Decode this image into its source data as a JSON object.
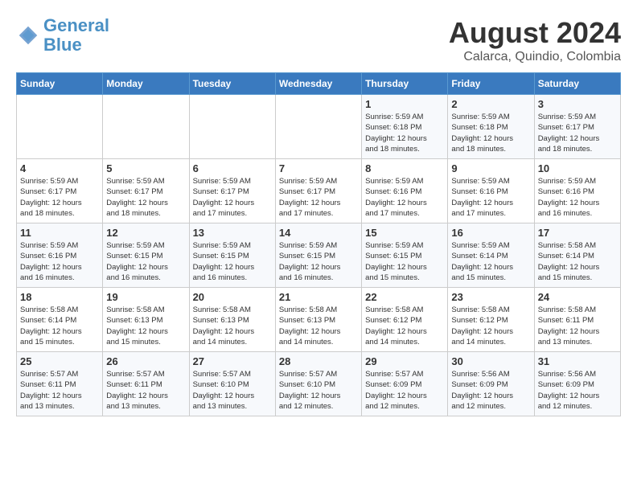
{
  "header": {
    "logo_line1": "General",
    "logo_line2": "Blue",
    "month_year": "August 2024",
    "location": "Calarca, Quindio, Colombia"
  },
  "weekdays": [
    "Sunday",
    "Monday",
    "Tuesday",
    "Wednesday",
    "Thursday",
    "Friday",
    "Saturday"
  ],
  "weeks": [
    [
      {
        "day": "",
        "detail": ""
      },
      {
        "day": "",
        "detail": ""
      },
      {
        "day": "",
        "detail": ""
      },
      {
        "day": "",
        "detail": ""
      },
      {
        "day": "1",
        "detail": "Sunrise: 5:59 AM\nSunset: 6:18 PM\nDaylight: 12 hours\nand 18 minutes."
      },
      {
        "day": "2",
        "detail": "Sunrise: 5:59 AM\nSunset: 6:18 PM\nDaylight: 12 hours\nand 18 minutes."
      },
      {
        "day": "3",
        "detail": "Sunrise: 5:59 AM\nSunset: 6:17 PM\nDaylight: 12 hours\nand 18 minutes."
      }
    ],
    [
      {
        "day": "4",
        "detail": "Sunrise: 5:59 AM\nSunset: 6:17 PM\nDaylight: 12 hours\nand 18 minutes."
      },
      {
        "day": "5",
        "detail": "Sunrise: 5:59 AM\nSunset: 6:17 PM\nDaylight: 12 hours\nand 18 minutes."
      },
      {
        "day": "6",
        "detail": "Sunrise: 5:59 AM\nSunset: 6:17 PM\nDaylight: 12 hours\nand 17 minutes."
      },
      {
        "day": "7",
        "detail": "Sunrise: 5:59 AM\nSunset: 6:17 PM\nDaylight: 12 hours\nand 17 minutes."
      },
      {
        "day": "8",
        "detail": "Sunrise: 5:59 AM\nSunset: 6:16 PM\nDaylight: 12 hours\nand 17 minutes."
      },
      {
        "day": "9",
        "detail": "Sunrise: 5:59 AM\nSunset: 6:16 PM\nDaylight: 12 hours\nand 17 minutes."
      },
      {
        "day": "10",
        "detail": "Sunrise: 5:59 AM\nSunset: 6:16 PM\nDaylight: 12 hours\nand 16 minutes."
      }
    ],
    [
      {
        "day": "11",
        "detail": "Sunrise: 5:59 AM\nSunset: 6:16 PM\nDaylight: 12 hours\nand 16 minutes."
      },
      {
        "day": "12",
        "detail": "Sunrise: 5:59 AM\nSunset: 6:15 PM\nDaylight: 12 hours\nand 16 minutes."
      },
      {
        "day": "13",
        "detail": "Sunrise: 5:59 AM\nSunset: 6:15 PM\nDaylight: 12 hours\nand 16 minutes."
      },
      {
        "day": "14",
        "detail": "Sunrise: 5:59 AM\nSunset: 6:15 PM\nDaylight: 12 hours\nand 16 minutes."
      },
      {
        "day": "15",
        "detail": "Sunrise: 5:59 AM\nSunset: 6:15 PM\nDaylight: 12 hours\nand 15 minutes."
      },
      {
        "day": "16",
        "detail": "Sunrise: 5:59 AM\nSunset: 6:14 PM\nDaylight: 12 hours\nand 15 minutes."
      },
      {
        "day": "17",
        "detail": "Sunrise: 5:58 AM\nSunset: 6:14 PM\nDaylight: 12 hours\nand 15 minutes."
      }
    ],
    [
      {
        "day": "18",
        "detail": "Sunrise: 5:58 AM\nSunset: 6:14 PM\nDaylight: 12 hours\nand 15 minutes."
      },
      {
        "day": "19",
        "detail": "Sunrise: 5:58 AM\nSunset: 6:13 PM\nDaylight: 12 hours\nand 15 minutes."
      },
      {
        "day": "20",
        "detail": "Sunrise: 5:58 AM\nSunset: 6:13 PM\nDaylight: 12 hours\nand 14 minutes."
      },
      {
        "day": "21",
        "detail": "Sunrise: 5:58 AM\nSunset: 6:13 PM\nDaylight: 12 hours\nand 14 minutes."
      },
      {
        "day": "22",
        "detail": "Sunrise: 5:58 AM\nSunset: 6:12 PM\nDaylight: 12 hours\nand 14 minutes."
      },
      {
        "day": "23",
        "detail": "Sunrise: 5:58 AM\nSunset: 6:12 PM\nDaylight: 12 hours\nand 14 minutes."
      },
      {
        "day": "24",
        "detail": "Sunrise: 5:58 AM\nSunset: 6:11 PM\nDaylight: 12 hours\nand 13 minutes."
      }
    ],
    [
      {
        "day": "25",
        "detail": "Sunrise: 5:57 AM\nSunset: 6:11 PM\nDaylight: 12 hours\nand 13 minutes."
      },
      {
        "day": "26",
        "detail": "Sunrise: 5:57 AM\nSunset: 6:11 PM\nDaylight: 12 hours\nand 13 minutes."
      },
      {
        "day": "27",
        "detail": "Sunrise: 5:57 AM\nSunset: 6:10 PM\nDaylight: 12 hours\nand 13 minutes."
      },
      {
        "day": "28",
        "detail": "Sunrise: 5:57 AM\nSunset: 6:10 PM\nDaylight: 12 hours\nand 12 minutes."
      },
      {
        "day": "29",
        "detail": "Sunrise: 5:57 AM\nSunset: 6:09 PM\nDaylight: 12 hours\nand 12 minutes."
      },
      {
        "day": "30",
        "detail": "Sunrise: 5:56 AM\nSunset: 6:09 PM\nDaylight: 12 hours\nand 12 minutes."
      },
      {
        "day": "31",
        "detail": "Sunrise: 5:56 AM\nSunset: 6:09 PM\nDaylight: 12 hours\nand 12 minutes."
      }
    ]
  ]
}
